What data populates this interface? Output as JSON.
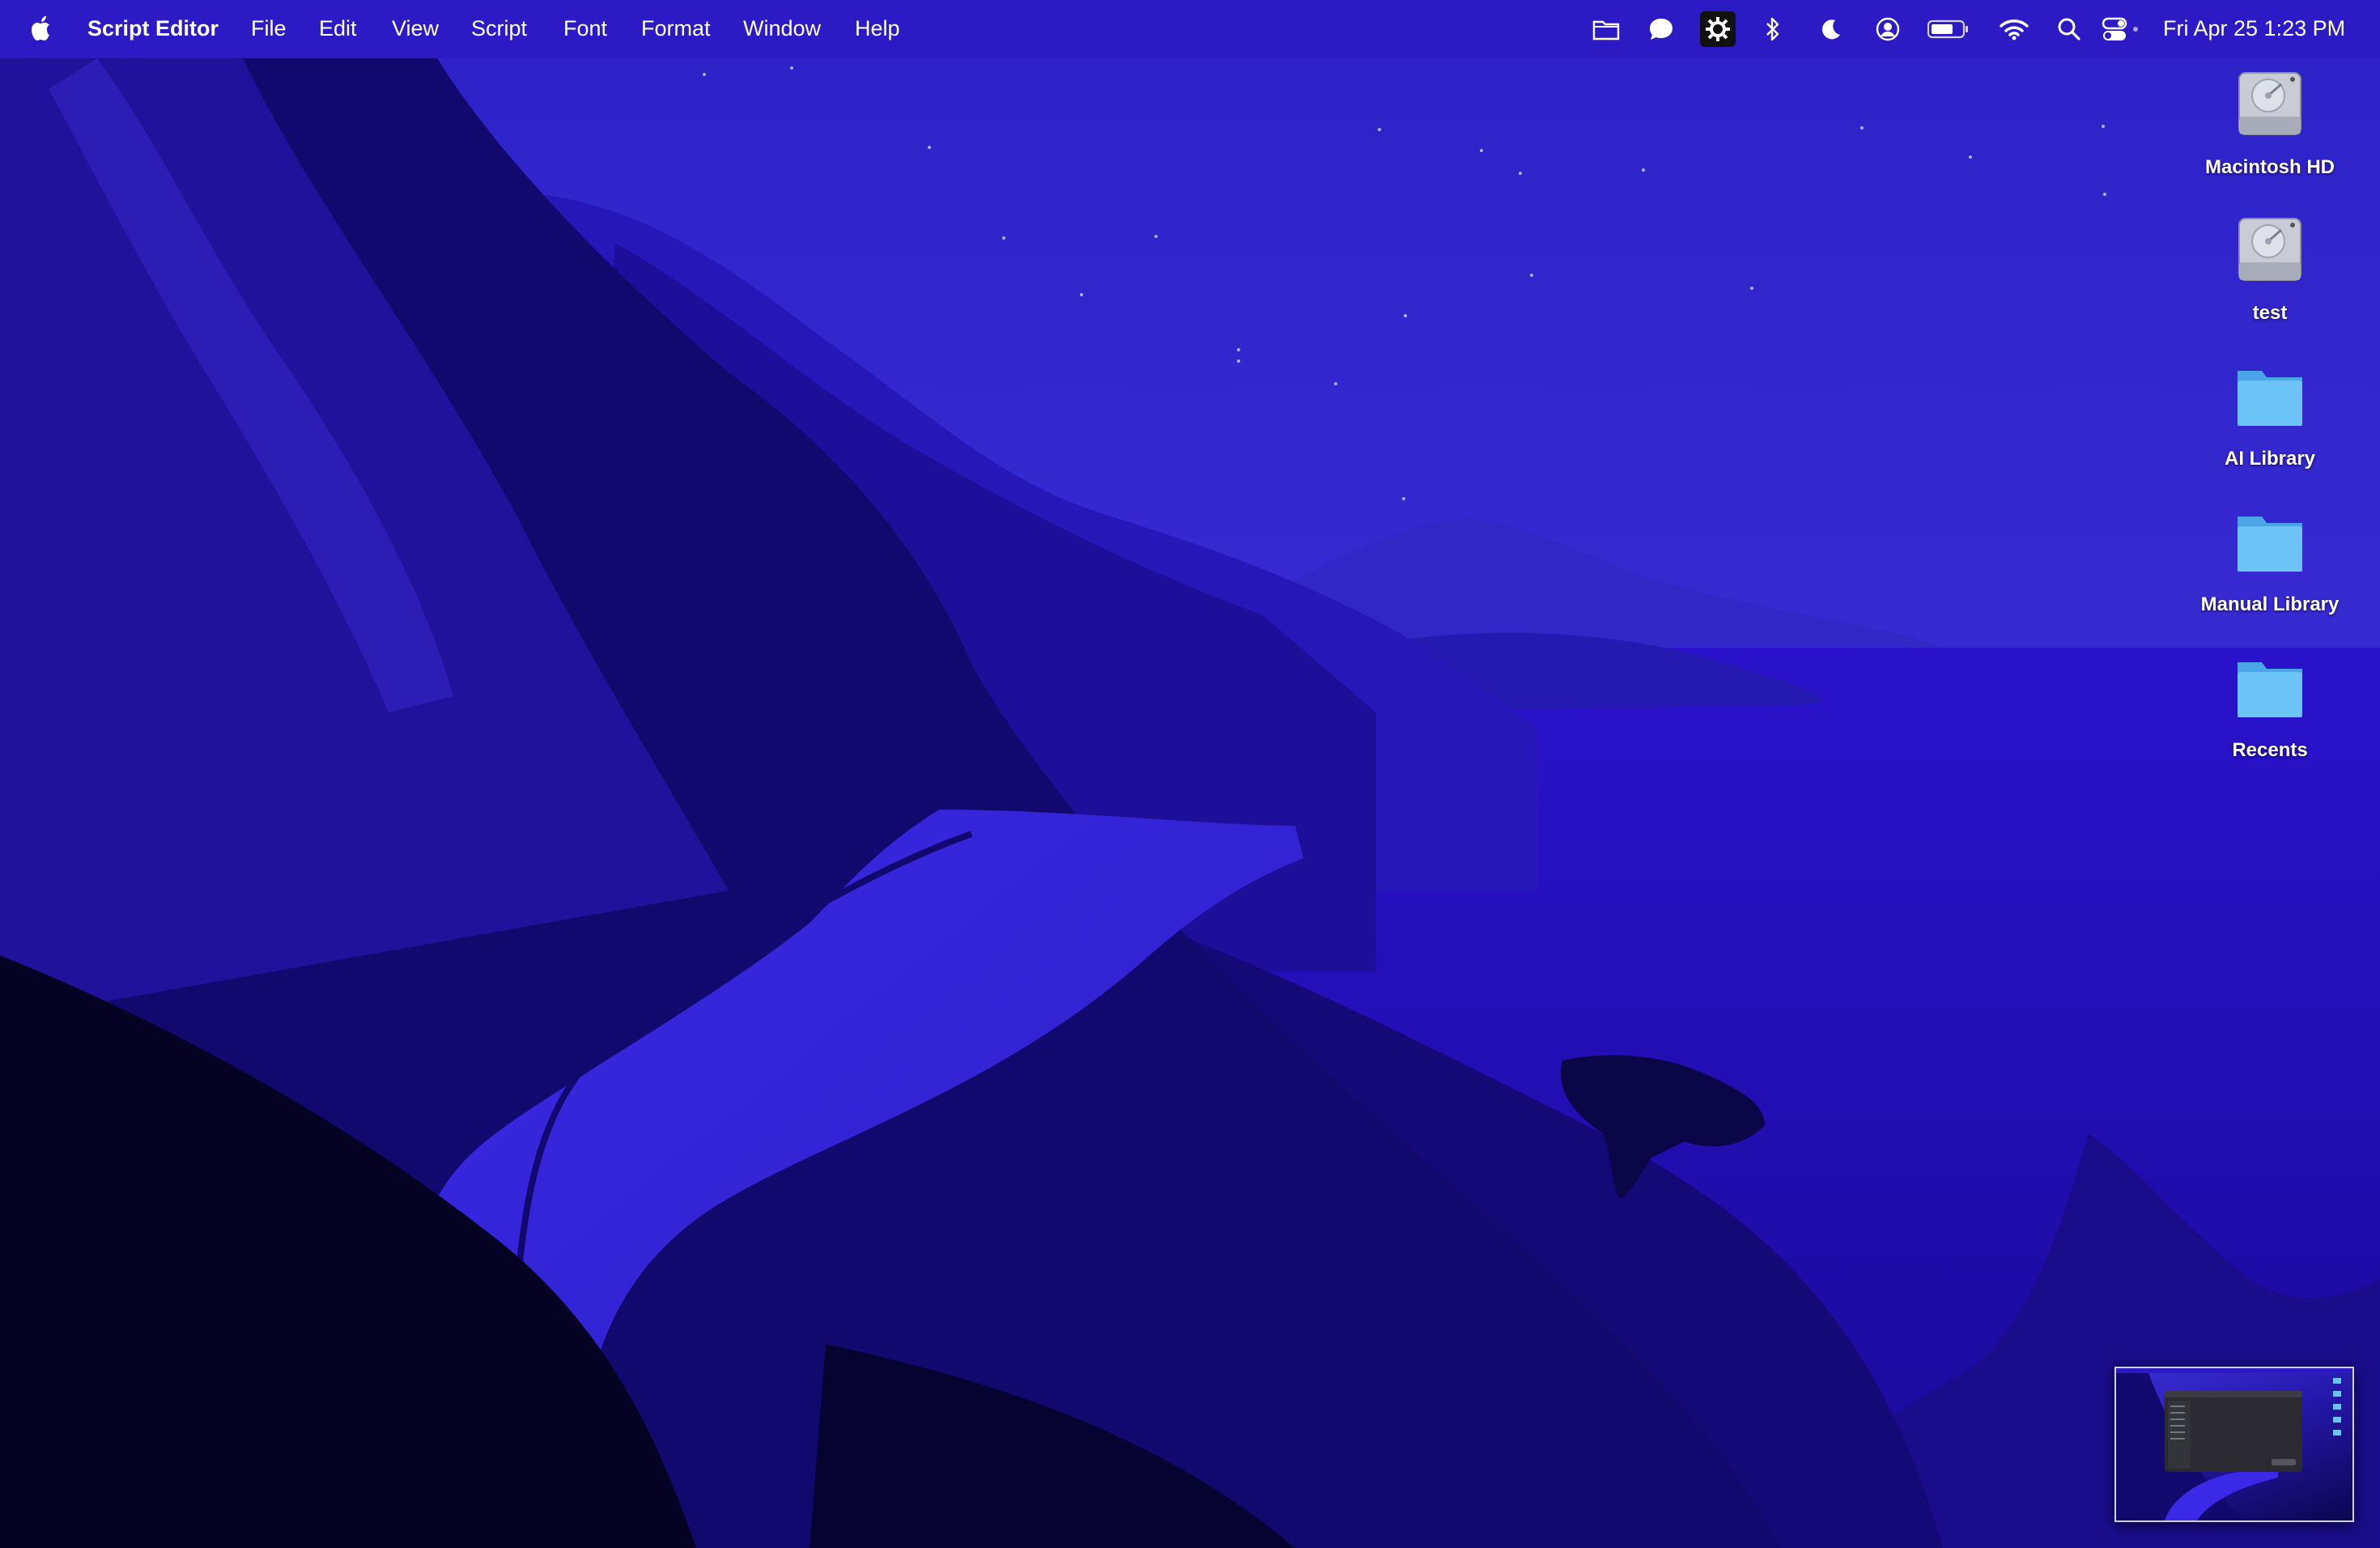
{
  "menubar": {
    "app_name": "Script Editor",
    "menus": [
      "File",
      "Edit",
      "View",
      "Script",
      "Font",
      "Format",
      "Window",
      "Help"
    ],
    "status_icons": [
      "folder-icon",
      "chat-bubble-icon",
      "gear-badge-icon",
      "bluetooth-icon",
      "do-not-disturb-moon-icon",
      "user-account-icon",
      "battery-icon",
      "wifi-icon",
      "search-icon",
      "control-center-icon"
    ],
    "datetime": "Fri Apr 25  1:23 PM"
  },
  "desktop": {
    "icons": [
      {
        "label": "Macintosh HD",
        "type": "drive"
      },
      {
        "label": "test",
        "type": "drive"
      },
      {
        "label": "AI Library",
        "type": "folder"
      },
      {
        "label": "Manual Library",
        "type": "folder"
      },
      {
        "label": "Recents",
        "type": "folder"
      }
    ]
  },
  "colors": {
    "menubar": "#2c1ac4",
    "sky": "#3a2fd6",
    "sea": "#2a11c6",
    "folder": "#5ab4ee"
  }
}
